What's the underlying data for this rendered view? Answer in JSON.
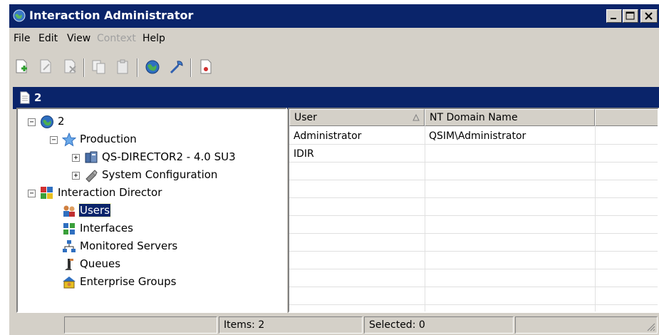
{
  "window": {
    "title": "Interaction Administrator"
  },
  "menu": [
    {
      "label": "File",
      "enabled": true
    },
    {
      "label": "Edit",
      "enabled": true
    },
    {
      "label": "View",
      "enabled": true
    },
    {
      "label": "Context",
      "enabled": false
    },
    {
      "label": "Help",
      "enabled": true
    }
  ],
  "toolbar": [
    "new-icon",
    "edit-icon",
    "delete-icon",
    "copy-icon",
    "paste-icon",
    "globe-icon",
    "tools-icon",
    "report-icon"
  ],
  "mdi": {
    "title": "2"
  },
  "tree": {
    "root": "2",
    "production": "Production",
    "server": "QS-DIRECTOR2 - 4.0 SU3",
    "sysconfig": "System Configuration",
    "director": "Interaction Director",
    "users": "Users",
    "interfaces": "Interfaces",
    "monitored": "Monitored Servers",
    "queues": "Queues",
    "enterprise": "Enterprise Groups"
  },
  "list": {
    "columns": [
      "User",
      "NT Domain Name"
    ],
    "rows": [
      [
        "Administrator",
        "QSIM\\Administrator"
      ],
      [
        "IDIR",
        ""
      ]
    ]
  },
  "status": {
    "items": "Items: 2",
    "selected": "Selected: 0"
  },
  "colors": {
    "titlebar": "#0a246a",
    "chrome": "#d4d0c8",
    "selection": "#0a246a"
  }
}
